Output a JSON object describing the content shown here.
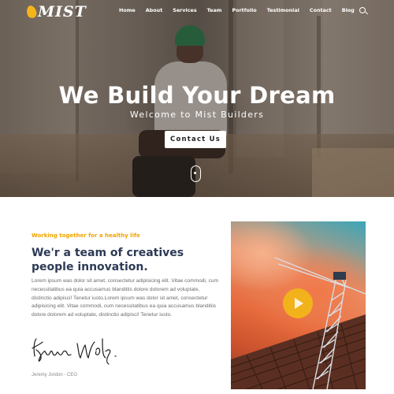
{
  "brand": {
    "logo_text": "MIST",
    "accent": "#f5b41c"
  },
  "nav": {
    "items": [
      {
        "label": "Home"
      },
      {
        "label": "About"
      },
      {
        "label": "Services"
      },
      {
        "label": "Team"
      },
      {
        "label": "Portfolio"
      },
      {
        "label": "Testimonial"
      },
      {
        "label": "Contact"
      },
      {
        "label": "Blog"
      }
    ],
    "search_icon": "search-icon"
  },
  "hero": {
    "title": "We Build Your Dream",
    "subtitle": "Welcome to Mist Builders",
    "cta_label": "Contact Us",
    "scroll_icon": "mouse-scroll-icon"
  },
  "about": {
    "tagline": "Working together for a healthy life",
    "heading": "We'r a team of creatives people innovation.",
    "body": "Lorem ipsum was dolor sit amet, consectetur adipisicing elit. Vitae commodi, cum necessitatibus ea quia accusamus blanditiis dolore dolorem ad voluptate, distinctio adipisci! Tenetur iusto.Lorem ipsum was dolor sit amet, consectetur adipisicing elit. Vitae commodi, cum necessitatibus ea quia accusamus blanditiis dolore dolorem ad voluptate, distinctio adipisci! Tenetur iusto.",
    "signature_text": "Kristina Wolf",
    "signature_name": "Jeremy Jordon - CEO"
  },
  "video": {
    "play_icon": "play-icon",
    "play_color": "#f2b21b"
  }
}
